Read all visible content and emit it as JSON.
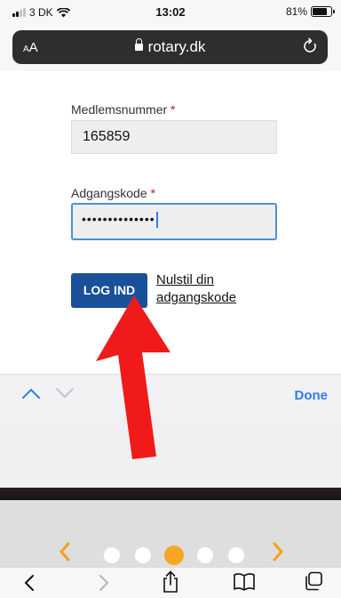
{
  "status": {
    "carrier": "3 DK",
    "time": "13:02",
    "battery_text": "81%",
    "battery_level": 0.81
  },
  "browser": {
    "aa_label_small": "A",
    "aa_label_big": "A",
    "domain": "rotary.dk"
  },
  "form": {
    "member_label": "Medlemsnummer",
    "member_value": "165859",
    "password_label": "Adgangskode",
    "password_value": "••••••••••••••",
    "required_mark": "*",
    "login_button": "LOG IND",
    "reset_link": "Nulstil din adgangskode"
  },
  "keyboard_bar": {
    "done_label": "Done"
  },
  "colors": {
    "accent_blue": "#2f7cf6",
    "login_button": "#1a4f9a",
    "arrow_red": "#f01a1a",
    "page_dot_active": "#f5a623"
  },
  "icons": {
    "toolbar": [
      "back-icon",
      "forward-icon",
      "share-icon",
      "bookmarks-icon",
      "tabs-icon"
    ]
  }
}
